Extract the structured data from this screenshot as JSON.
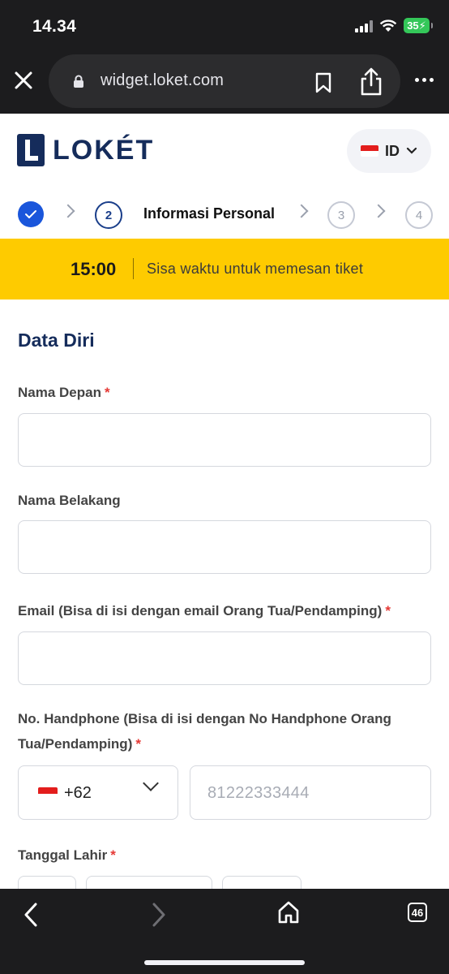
{
  "status_bar": {
    "time": "14.34",
    "battery": "35"
  },
  "browser": {
    "url": "widget.loket.com",
    "tab_count": "46"
  },
  "header": {
    "logo_text": "LOKÉT",
    "language": "ID"
  },
  "stepper": {
    "step2": "2",
    "step2_label": "Informasi Personal",
    "step3": "3",
    "step4": "4"
  },
  "timer": {
    "value": "15:00",
    "text": "Sisa waktu untuk memesan tiket"
  },
  "form": {
    "section_title": "Data Diri",
    "first_name_label": "Nama Depan",
    "last_name_label": "Nama Belakang",
    "email_label": "Email (Bisa di isi dengan email Orang Tua/Pendamping)",
    "phone_label": "No. Handphone (Bisa di isi dengan No Handphone Orang Tua/Pendamping)",
    "phone_code": "+62",
    "phone_placeholder": "81222333444",
    "birth_date_label": "Tanggal Lahir",
    "required_mark": "*"
  },
  "colors": {
    "brand": "#152c5b",
    "accent": "#1a56db",
    "banner": "#fecb00",
    "required": "#e53935"
  }
}
